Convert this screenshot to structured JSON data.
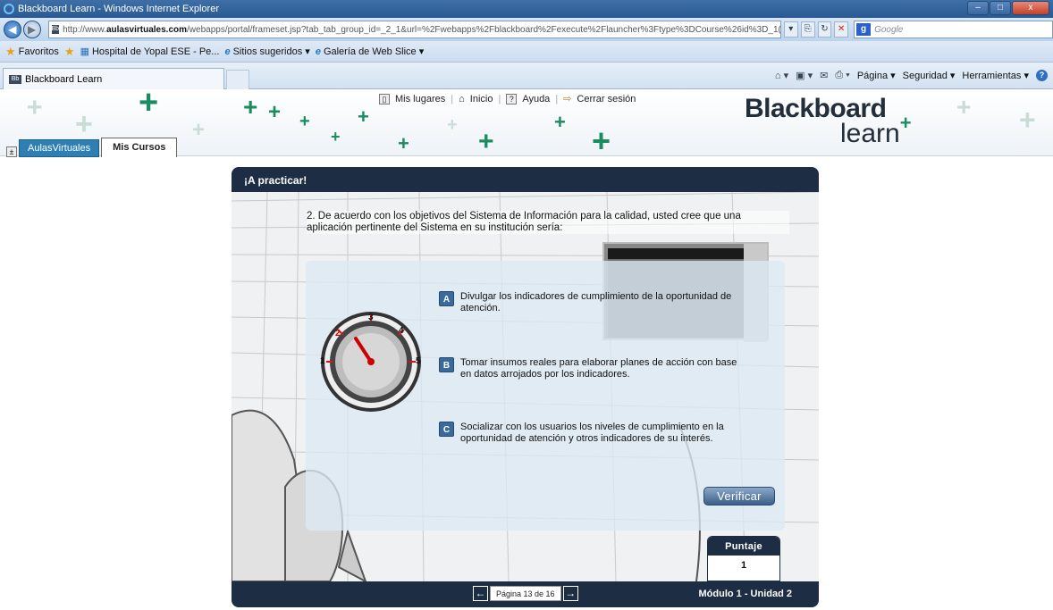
{
  "window": {
    "title": "Blackboard Learn - Windows Internet Explorer",
    "min": "–",
    "max": "□",
    "close": "x"
  },
  "address": {
    "prefix": "http://www.",
    "domain": "aulasvirtuales.com",
    "path": "/webapps/portal/frameset.jsp?tab_tab_group_id=_2_1&url=%2Fwebapps%2Fblackboard%2Fexecute%2Flauncher%3Ftype%3DCourse%26id%3D_1(",
    "favicon": "Bb",
    "search_placeholder": "Google",
    "search_logo": "g"
  },
  "favorites": {
    "label": "Favoritos",
    "items": [
      "Hospital de Yopal ESE - Pe...",
      "Sitios sugeridos ▾",
      "Galería de Web Slice ▾"
    ]
  },
  "ie_tab": {
    "label": "Blackboard Learn",
    "favicon": "Bb"
  },
  "command_bar": {
    "page": "Página ▾",
    "security": "Seguridad ▾",
    "tools": "Herramientas ▾",
    "help": "?"
  },
  "bb_header": {
    "links": [
      "Mis lugares",
      "Inicio",
      "Ayuda",
      "Cerrar sesión"
    ],
    "logo_top": "Blackboard",
    "logo_bottom": "learn",
    "logo_plus": "+",
    "tab_toggle": "±",
    "tabs": [
      "AulasVirtuales",
      "Mis Cursos"
    ]
  },
  "module": {
    "header": "¡A practicar!",
    "question": "2. De acuerdo con los objetivos del Sistema de Información para la calidad, usted cree que una aplicación pertinente del Sistema en su institución sería:",
    "options": [
      {
        "letter": "A",
        "text": "Divulgar los indicadores de cumplimiento de la oportunidad de atención."
      },
      {
        "letter": "B",
        "text": "Tomar insumos reales para elaborar planes de acción con base en datos arrojados por los indicadores."
      },
      {
        "letter": "C",
        "text": "Socializar con los usuarios los niveles de cumplimiento en la oportunidad de atención y otros indicadores de su interés."
      }
    ],
    "gauge_labels": [
      "1",
      "2",
      "3",
      "4",
      "5"
    ],
    "verify_label": "Verificar",
    "score_label": "Puntaje",
    "score_value": "1",
    "page_indicator": "Página 13 de 16",
    "prev": "←",
    "next": "→",
    "footer_label": "Módulo 1 - Unidad 2"
  },
  "colors": {
    "accent_navy": "#1c2d44",
    "bb_green": "#1a8c5f",
    "tab_blue": "#2d7fb4"
  }
}
